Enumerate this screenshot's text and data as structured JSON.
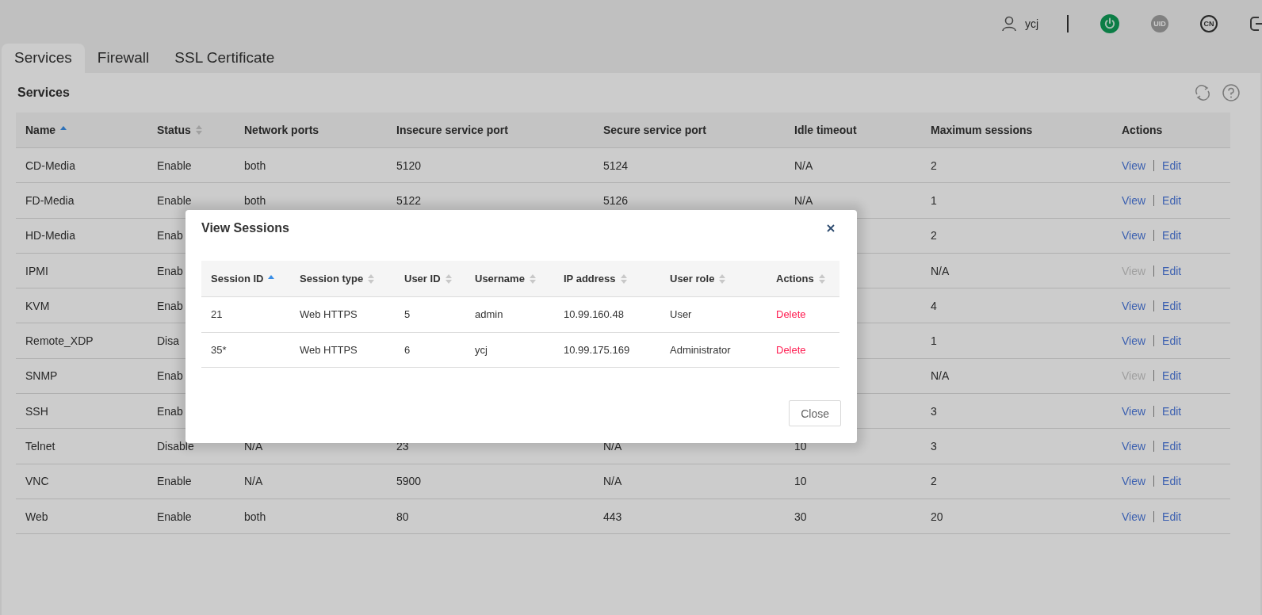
{
  "header": {
    "username": "ycj",
    "uid_badge": "UID",
    "language_badge": "CN"
  },
  "tabs": [
    {
      "label": "Services",
      "selected": true
    },
    {
      "label": "Firewall",
      "selected": false
    },
    {
      "label": "SSL Certificate",
      "selected": false
    }
  ],
  "panel": {
    "title": "Services",
    "table": {
      "columns": [
        {
          "label": "Name",
          "sortable": true,
          "sorted": true
        },
        {
          "label": "Status",
          "sortable": true,
          "sorted": false
        },
        {
          "label": "Network ports"
        },
        {
          "label": "Insecure service port"
        },
        {
          "label": "Secure service port"
        },
        {
          "label": "Idle timeout"
        },
        {
          "label": "Maximum sessions"
        },
        {
          "label": "Actions"
        }
      ],
      "rows": [
        {
          "cells": [
            "CD-Media",
            "Enable",
            "both",
            "5120",
            "5124",
            "N/A",
            "2"
          ],
          "actions": [
            {
              "label": "View",
              "disabled": false
            },
            {
              "label": "Edit",
              "disabled": false
            }
          ]
        },
        {
          "cells": [
            "FD-Media",
            "Enable",
            "both",
            "5122",
            "5126",
            "N/A",
            "1"
          ],
          "actions": [
            {
              "label": "View",
              "disabled": false
            },
            {
              "label": "Edit",
              "disabled": false
            }
          ]
        },
        {
          "cells": [
            "HD-Media",
            "Enab",
            null,
            null,
            null,
            null,
            "2"
          ],
          "actions": [
            {
              "label": "View",
              "disabled": false
            },
            {
              "label": "Edit",
              "disabled": false
            }
          ]
        },
        {
          "cells": [
            "IPMI",
            "Enab",
            null,
            null,
            null,
            null,
            "N/A"
          ],
          "actions": [
            {
              "label": "View",
              "disabled": true
            },
            {
              "label": "Edit",
              "disabled": false
            }
          ]
        },
        {
          "cells": [
            "KVM",
            "Enab",
            null,
            null,
            null,
            null,
            "4"
          ],
          "actions": [
            {
              "label": "View",
              "disabled": false
            },
            {
              "label": "Edit",
              "disabled": false
            }
          ]
        },
        {
          "cells": [
            "Remote_XDP",
            "Disa",
            null,
            null,
            null,
            null,
            "1"
          ],
          "actions": [
            {
              "label": "View",
              "disabled": false
            },
            {
              "label": "Edit",
              "disabled": false
            }
          ]
        },
        {
          "cells": [
            "SNMP",
            "Enab",
            null,
            null,
            null,
            null,
            "N/A"
          ],
          "actions": [
            {
              "label": "View",
              "disabled": true
            },
            {
              "label": "Edit",
              "disabled": false
            }
          ]
        },
        {
          "cells": [
            "SSH",
            "Enab",
            null,
            null,
            null,
            null,
            "3"
          ],
          "actions": [
            {
              "label": "View",
              "disabled": false
            },
            {
              "label": "Edit",
              "disabled": false
            }
          ]
        },
        {
          "cells": [
            "Telnet",
            "Disable",
            "N/A",
            "23",
            "N/A",
            "10",
            "3"
          ],
          "actions": [
            {
              "label": "View",
              "disabled": false
            },
            {
              "label": "Edit",
              "disabled": false
            }
          ]
        },
        {
          "cells": [
            "VNC",
            "Enable",
            "N/A",
            "5900",
            "N/A",
            "10",
            "2"
          ],
          "actions": [
            {
              "label": "View",
              "disabled": false
            },
            {
              "label": "Edit",
              "disabled": false
            }
          ]
        },
        {
          "cells": [
            "Web",
            "Enable",
            "both",
            "80",
            "443",
            "30",
            "20"
          ],
          "actions": [
            {
              "label": "View",
              "disabled": false
            },
            {
              "label": "Edit",
              "disabled": false
            }
          ]
        }
      ]
    }
  },
  "dialog": {
    "title": "View Sessions",
    "columns": [
      {
        "label": "Session ID",
        "sortable": true,
        "sorted": true
      },
      {
        "label": "Session type",
        "sortable": true,
        "sorted": false
      },
      {
        "label": "User ID",
        "sortable": true,
        "sorted": false
      },
      {
        "label": "Username",
        "sortable": true,
        "sorted": false
      },
      {
        "label": "IP address",
        "sortable": true,
        "sorted": false
      },
      {
        "label": "User role",
        "sortable": true,
        "sorted": false
      },
      {
        "label": "Actions",
        "sortable": true,
        "sorted": false
      }
    ],
    "rows": [
      {
        "cells": [
          "21",
          "Web HTTPS",
          "5",
          "admin",
          "10.99.160.48",
          "User"
        ],
        "action": "Delete"
      },
      {
        "cells": [
          "35*",
          "Web HTTPS",
          "6",
          "ycj",
          "10.99.175.169",
          "Administrator"
        ],
        "action": "Delete"
      }
    ],
    "close_button": "Close"
  }
}
